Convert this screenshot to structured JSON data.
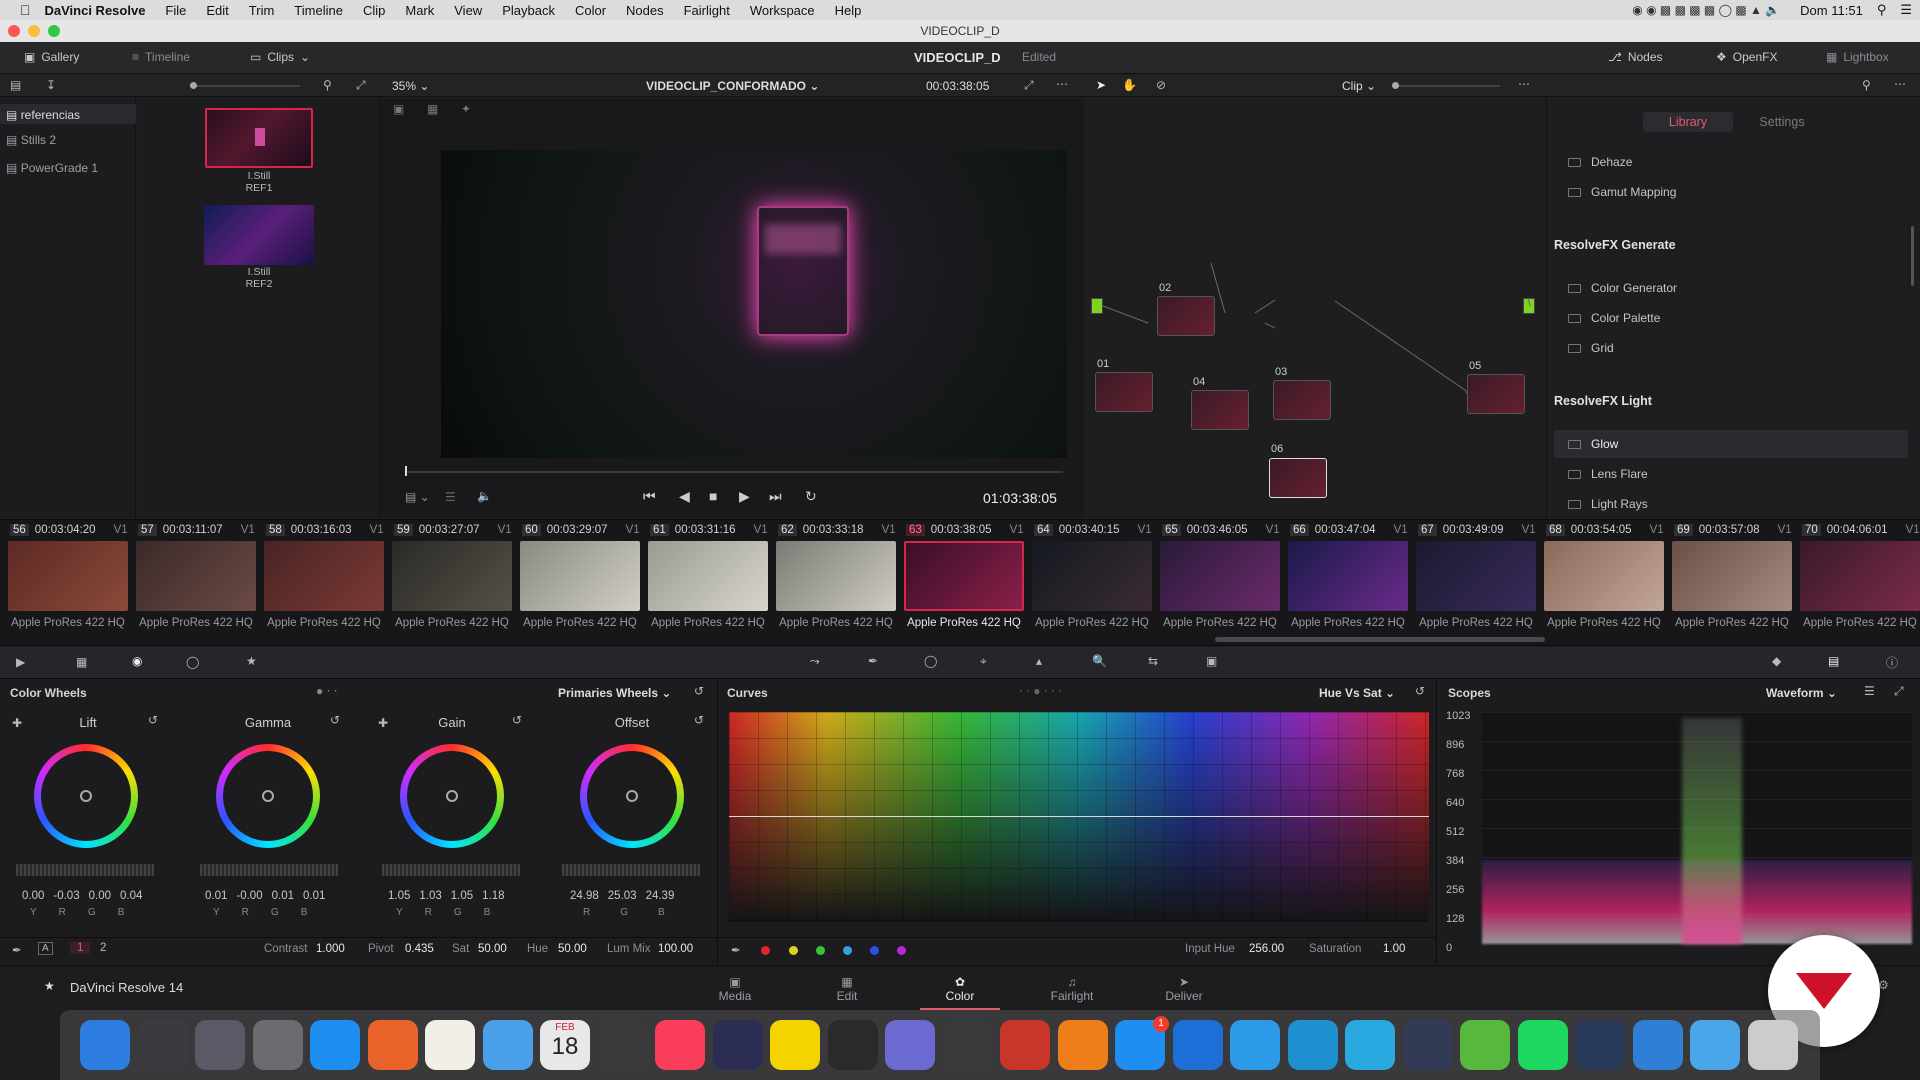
{
  "menubar": {
    "app": "DaVinci Resolve",
    "items": [
      "File",
      "Edit",
      "Trim",
      "Timeline",
      "Clip",
      "Mark",
      "View",
      "Playback",
      "Color",
      "Nodes",
      "Fairlight",
      "Workspace",
      "Help"
    ],
    "clock": "Dom 11:51"
  },
  "window": {
    "title": "VIDEOCLIP_D"
  },
  "topbar": {
    "gallery": "Gallery",
    "timeline": "Timeline",
    "clips": "Clips",
    "project": "VIDEOCLIP_D",
    "status": "Edited",
    "nodes": "Nodes",
    "openfx": "OpenFX",
    "lightbox": "Lightbox"
  },
  "viewer": {
    "zoom": "35%",
    "timeline_name": "VIDEOCLIP_CONFORMADO",
    "timecode_top": "00:03:38:05",
    "clip_mode": "Clip",
    "timecode": "01:03:38:05"
  },
  "gallery": {
    "albums": [
      "referencias",
      "Stills 2",
      "PowerGrade 1"
    ],
    "stills": [
      {
        "name": "I.Still",
        "ref": "REF1"
      },
      {
        "name": "I.Still",
        "ref": "REF2"
      }
    ]
  },
  "nodes": [
    "01",
    "02",
    "03",
    "04",
    "05",
    "06"
  ],
  "library": {
    "tabs": [
      "Library",
      "Settings"
    ],
    "items_top": [
      "Dehaze",
      "Gamut Mapping"
    ],
    "sections": [
      {
        "title": "ResolveFX Generate",
        "items": [
          "Color Generator",
          "Color Palette",
          "Grid"
        ]
      },
      {
        "title": "ResolveFX Light",
        "items": [
          "Glow",
          "Lens Flare",
          "Light Rays"
        ]
      }
    ]
  },
  "clips": [
    {
      "n": "56",
      "tc": "00:03:04:20",
      "tr": "V1"
    },
    {
      "n": "57",
      "tc": "00:03:11:07",
      "tr": "V1"
    },
    {
      "n": "58",
      "tc": "00:03:16:03",
      "tr": "V1"
    },
    {
      "n": "59",
      "tc": "00:03:27:07",
      "tr": "V1"
    },
    {
      "n": "60",
      "tc": "00:03:29:07",
      "tr": "V1"
    },
    {
      "n": "61",
      "tc": "00:03:31:16",
      "tr": "V1"
    },
    {
      "n": "62",
      "tc": "00:03:33:18",
      "tr": "V1"
    },
    {
      "n": "63",
      "tc": "00:03:38:05",
      "tr": "V1"
    },
    {
      "n": "64",
      "tc": "00:03:40:15",
      "tr": "V1"
    },
    {
      "n": "65",
      "tc": "00:03:46:05",
      "tr": "V1"
    },
    {
      "n": "66",
      "tc": "00:03:47:04",
      "tr": "V1"
    },
    {
      "n": "67",
      "tc": "00:03:49:09",
      "tr": "V1"
    },
    {
      "n": "68",
      "tc": "00:03:54:05",
      "tr": "V1"
    },
    {
      "n": "69",
      "tc": "00:03:57:08",
      "tr": "V1"
    },
    {
      "n": "70",
      "tc": "00:04:06:01",
      "tr": "V1"
    }
  ],
  "clip_format": "Apple ProRes 422 HQ",
  "color_wheels": {
    "title": "Color Wheels",
    "mode": "Primaries Wheels",
    "wheels": [
      {
        "label": "Lift",
        "values": [
          "0.00",
          "-0.03",
          "0.00",
          "0.04"
        ],
        "chans": [
          "Y",
          "R",
          "G",
          "B"
        ]
      },
      {
        "label": "Gamma",
        "values": [
          "0.01",
          "-0.00",
          "0.01",
          "0.01"
        ],
        "chans": [
          "Y",
          "R",
          "G",
          "B"
        ]
      },
      {
        "label": "Gain",
        "values": [
          "1.05",
          "1.03",
          "1.05",
          "1.18"
        ],
        "chans": [
          "Y",
          "R",
          "G",
          "B"
        ]
      },
      {
        "label": "Offset",
        "values": [
          "24.98",
          "25.03",
          "24.39"
        ],
        "chans": [
          "R",
          "G",
          "B"
        ]
      }
    ],
    "page1": "1",
    "page2": "2",
    "contrast_label": "Contrast",
    "contrast": "1.000",
    "pivot_label": "Pivot",
    "pivot": "0.435",
    "sat_label": "Sat",
    "sat": "50.00",
    "hue_label": "Hue",
    "hue": "50.00",
    "lummix_label": "Lum Mix",
    "lummix": "100.00"
  },
  "curves": {
    "title": "Curves",
    "mode": "Hue Vs Sat",
    "input_hue_label": "Input Hue",
    "input_hue": "256.00",
    "saturation_label": "Saturation",
    "saturation": "1.00",
    "dot_colors": [
      "#e0262b",
      "#d8d51d",
      "#36c436",
      "#35a2e0",
      "#2e4fe6",
      "#b429d6"
    ]
  },
  "scopes": {
    "title": "Scopes",
    "mode": "Waveform",
    "ticks": [
      "1023",
      "896",
      "768",
      "640",
      "512",
      "384",
      "256",
      "128",
      "0"
    ]
  },
  "pages": [
    "Media",
    "Edit",
    "Color",
    "Fairlight",
    "Deliver"
  ],
  "product": "DaVinci Resolve 14",
  "dock": {
    "calendar_month": "FEB",
    "calendar_day": "18",
    "badge": "1"
  }
}
